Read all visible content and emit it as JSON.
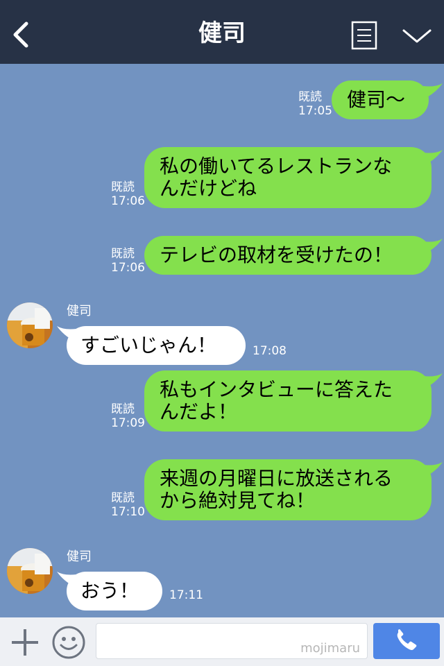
{
  "header": {
    "title": "健司",
    "back_icon": "chevron-left-icon",
    "menu_icon": "list-icon",
    "expand_icon": "chevron-down-icon"
  },
  "colors": {
    "header_bg": "#273246",
    "chat_bg": "#7293c1",
    "outgoing_bubble": "#84e04d",
    "incoming_bubble": "#ffffff",
    "send_button": "#4f86e6"
  },
  "messages": [
    {
      "from": "me",
      "lines": [
        "健司〜"
      ],
      "read": "既読",
      "time": "17:05"
    },
    {
      "from": "me",
      "lines": [
        "私の働いてるレストランな",
        "んだけどね"
      ],
      "read": "既読",
      "time": "17:06"
    },
    {
      "from": "me",
      "lines": [
        "テレビの取材を受けたの！"
      ],
      "read": "既読",
      "time": "17:06"
    },
    {
      "from": "other",
      "sender": "健司",
      "lines": [
        "すごいじゃん！"
      ],
      "time": "17:08"
    },
    {
      "from": "me",
      "lines": [
        "私もインタビューに答えた",
        "んだよ！"
      ],
      "read": "既読",
      "time": "17:09"
    },
    {
      "from": "me",
      "lines": [
        "来週の月曜日に放送される",
        "から絶対見てね！"
      ],
      "read": "既読",
      "time": "17:10"
    },
    {
      "from": "other",
      "sender": "健司",
      "lines": [
        "おう！"
      ],
      "time": "17:11"
    }
  ],
  "inputbar": {
    "plus_icon": "plus-icon",
    "emoji_icon": "smiley-icon",
    "watermark": "mojimaru",
    "call_icon": "phone-icon"
  }
}
